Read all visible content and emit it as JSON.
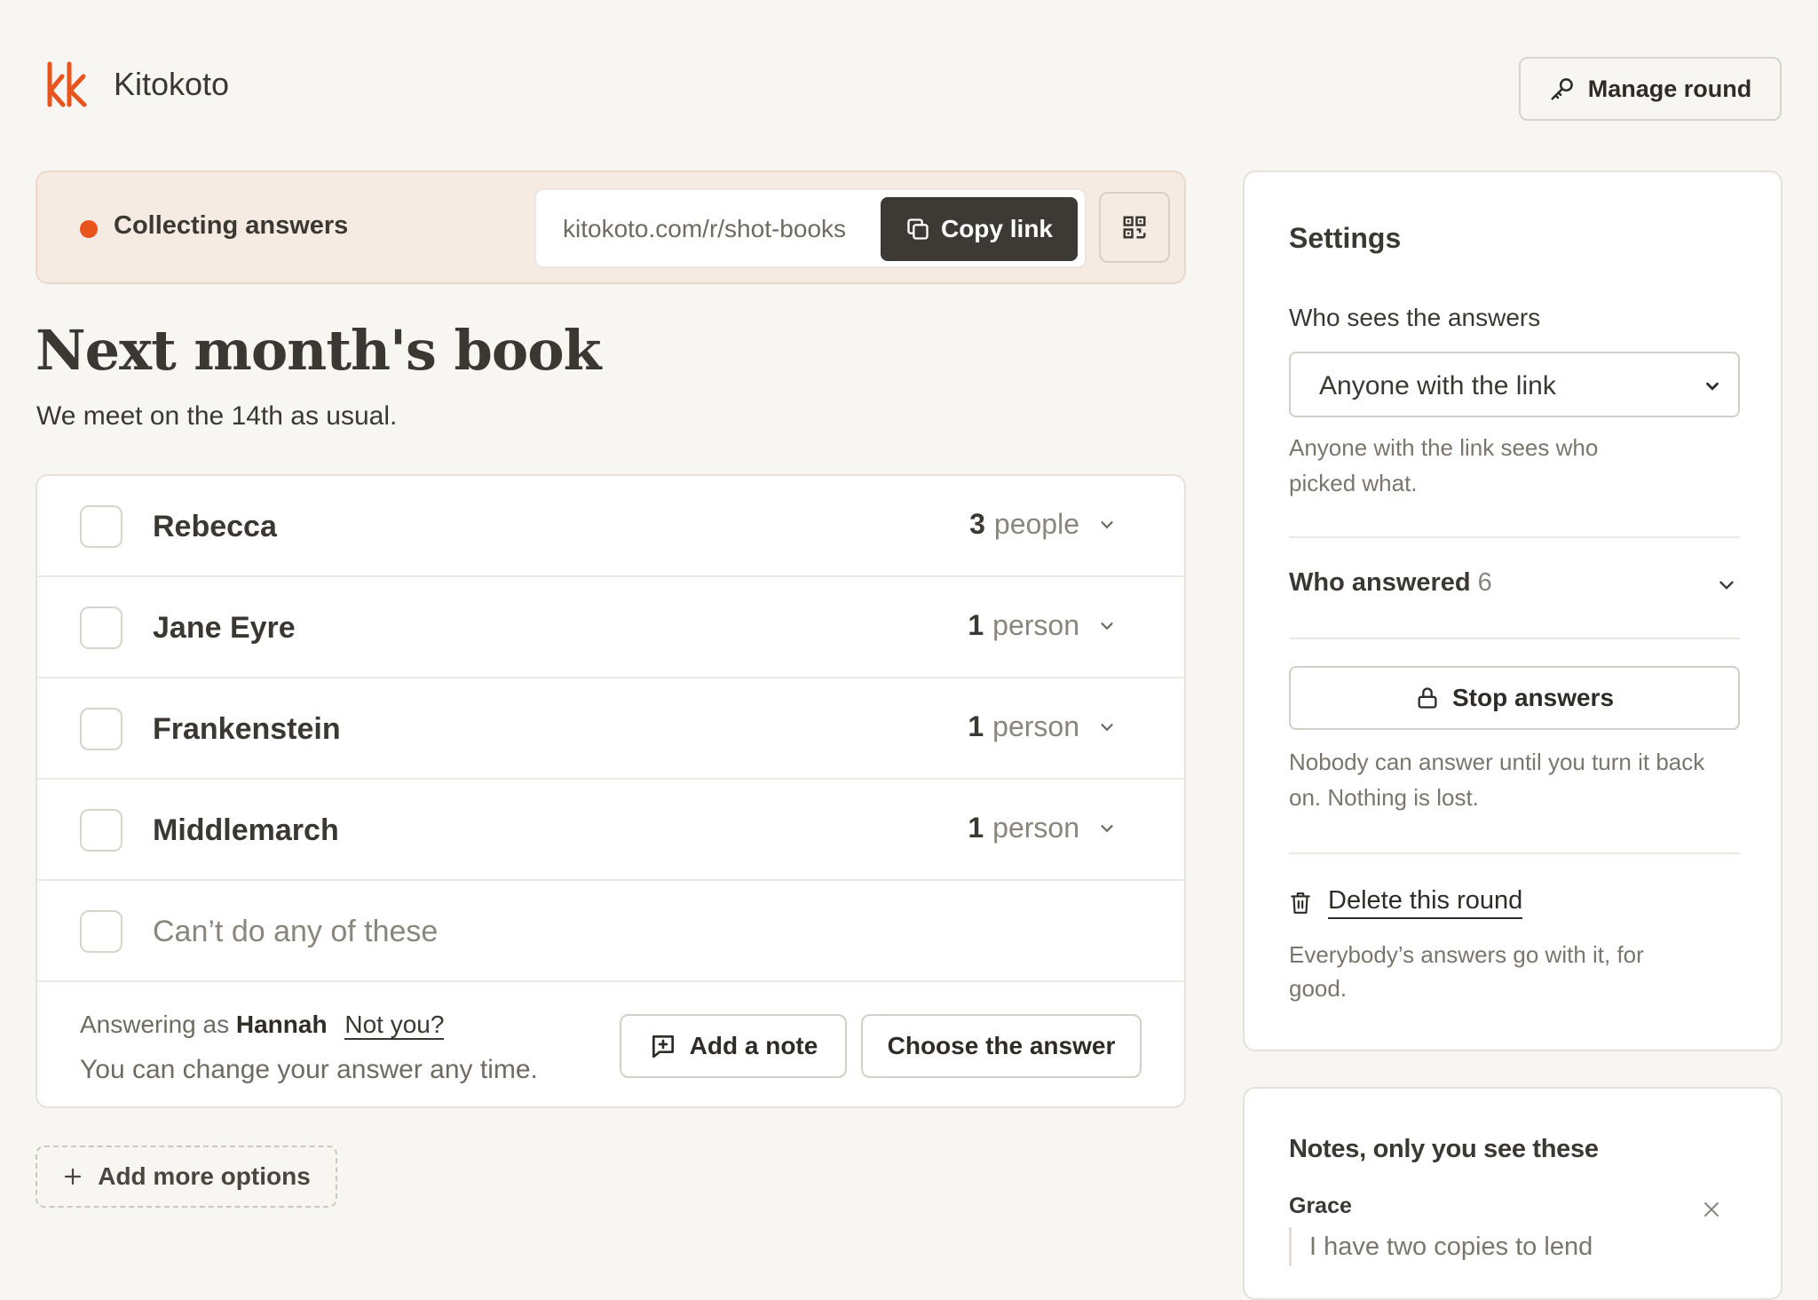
{
  "brand": {
    "name": "Kitokoto",
    "logo_text": "kk",
    "accent": "#e8541c"
  },
  "header": {
    "manage_label": "Manage round"
  },
  "status": {
    "label": "Collecting answers",
    "dot_color": "#e8541c",
    "link": "kitokoto.com/r/shot-books",
    "copy_label": "Copy link"
  },
  "round": {
    "title": "Next month's book",
    "subtitle": "We meet on the 14th as usual."
  },
  "options": [
    {
      "label": "Rebecca",
      "count": "3",
      "unit": "people"
    },
    {
      "label": "Jane Eyre",
      "count": "1",
      "unit": "person"
    },
    {
      "label": "Frankenstein",
      "count": "1",
      "unit": "person"
    },
    {
      "label": "Middlemarch",
      "count": "1",
      "unit": "person"
    },
    {
      "label": "Can’t do any of these"
    }
  ],
  "answer": {
    "prefix": "Answering as",
    "user": "Hannah",
    "not_you": "Not you?",
    "change_note": "You can change your answer any time.",
    "add_note_label": "Add a note",
    "choose_label": "Choose the answer"
  },
  "add_more_label": "Add more options",
  "settings": {
    "title": "Settings",
    "visibility_label": "Who sees the answers",
    "visibility_value": "Anyone with the link",
    "visibility_help": "Anyone with the link sees who picked what.",
    "who_answered_label": "Who answered",
    "who_answered_count": "6",
    "stop_label": "Stop answers",
    "stop_help": "Nobody can answer until you turn it back on. Nothing is lost.",
    "delete_label": "Delete this round",
    "delete_help": "Everybody’s answers go with it, for good."
  },
  "notes": {
    "title": "Notes, only you see these",
    "items": [
      {
        "name": "Grace",
        "text": "I have two copies to lend"
      }
    ]
  }
}
